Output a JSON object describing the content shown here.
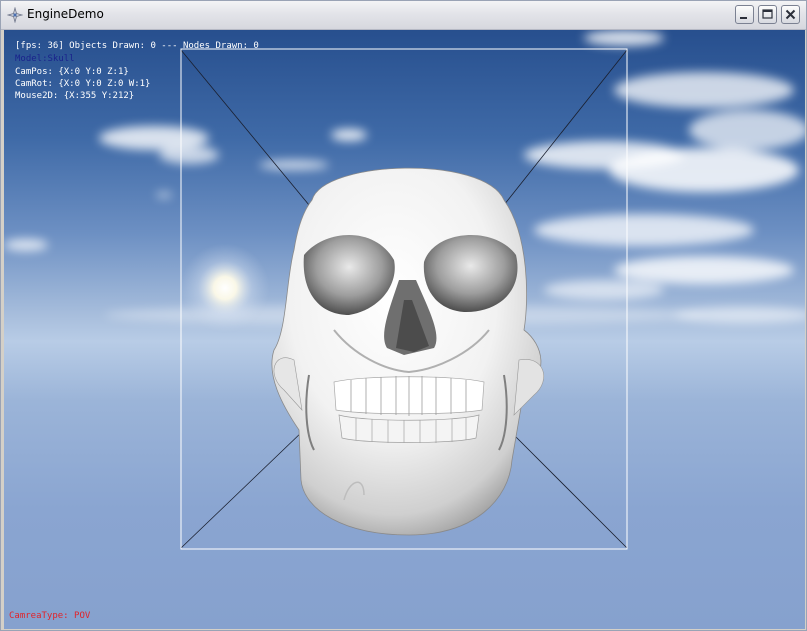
{
  "window": {
    "title": "EngineDemo",
    "buttons": [
      "minimize",
      "maximize",
      "close"
    ]
  },
  "hud": {
    "fps_line": "[fps: 36] Objects Drawn: 0 --- Nodes Drawn: 0",
    "model_line": "Model:Skull",
    "campos_line": "CamPos: {X:0 Y:0 Z:1}",
    "camrot_line": "CamRot: {X:0 Y:0 Z:0 W:1}",
    "mouse_line": "Mouse2D: {X:355 Y:212}",
    "camera_type_line": "CamreaType: POV"
  },
  "scene": {
    "model": "skull",
    "background": "sky",
    "bounding_box": true
  },
  "colors": {
    "hud_text": "#ffffff",
    "model_label": "#1a238c",
    "camera_type_label": "#e0242a"
  }
}
